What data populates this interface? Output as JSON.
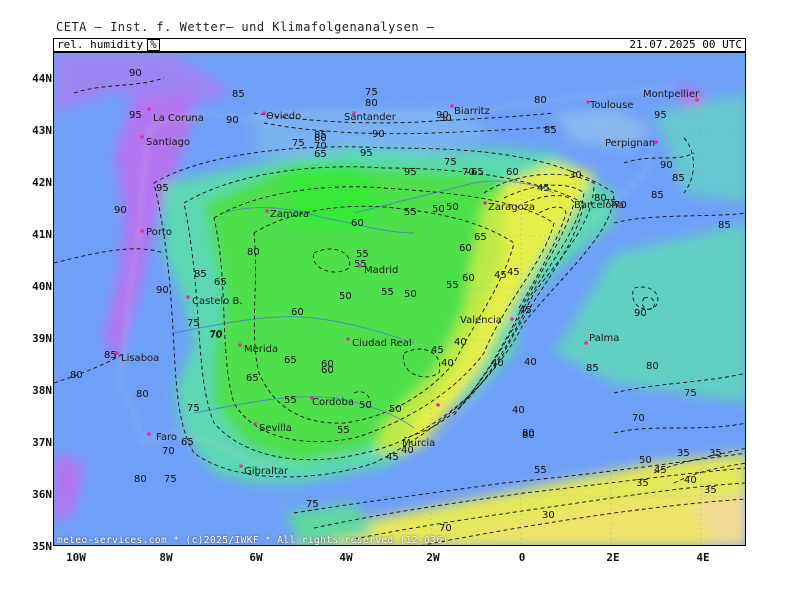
{
  "header": {
    "title": "CETA — Inst. f. Wetter— und Klimafolgenanalysen —",
    "parameter": "rel. humidity",
    "unit": "%",
    "timestamp": "21.07.2025 00 UTC",
    "copyright": "meteo-services.com * (c)2025/IWKF * All rights reserved (12-036)"
  },
  "axes": {
    "lat_labels": [
      "44N",
      "43N",
      "42N",
      "41N",
      "40N",
      "39N",
      "38N",
      "37N",
      "36N",
      "35N"
    ],
    "lon_labels": [
      "10W",
      "8W",
      "6W",
      "4W",
      "2W",
      "0",
      "2E",
      "4E"
    ]
  },
  "cities": [
    "La Coruna",
    "Oviedo",
    "Santander",
    "Biarritz",
    "Toulouse",
    "Montpellier",
    "Santiago",
    "Perpignan",
    "Zaragoza",
    "Zamora",
    "Barcelona",
    "Porto",
    "Madrid",
    "Castelo B.",
    "Valencia",
    "Lisaboa",
    "Merida",
    "Ciudad Real",
    "Palma",
    "Faro",
    "Cordoba",
    "Sevilla",
    "Murcia",
    "Gibraltar"
  ],
  "contour_labels": [
    "90",
    "85",
    "95",
    "90",
    "75",
    "80",
    "85",
    "90",
    "95",
    "80",
    "75",
    "70",
    "65",
    "95",
    "95",
    "90",
    "85",
    "80",
    "75",
    "70",
    "65",
    "60",
    "55",
    "50",
    "45",
    "40",
    "35",
    "90",
    "85",
    "80",
    "60",
    "55",
    "50",
    "60",
    "55",
    "45",
    "40",
    "90",
    "85",
    "80",
    "75",
    "70",
    "65",
    "60",
    "55",
    "50",
    "45",
    "40",
    "80",
    "85",
    "90",
    "80",
    "75",
    "70",
    "65",
    "60",
    "55",
    "50",
    "45",
    "40",
    "85",
    "80",
    "75",
    "70",
    "65",
    "80",
    "75",
    "70",
    "65",
    "60",
    "55",
    "50",
    "45",
    "40",
    "35",
    "30",
    "80",
    "75",
    "70",
    "55",
    "50",
    "45",
    "40",
    "35",
    "30",
    "85",
    "80",
    "75",
    "70",
    "65",
    "60",
    "55",
    "50",
    "45",
    "40",
    "35",
    "30",
    "95",
    "90",
    "85",
    "80"
  ],
  "colors": {
    "sea_humid": "#6fa0f8",
    "very_humid": "#b475f0",
    "dry_interior": "#4ee04c",
    "very_dry": "#e6ef4a"
  }
}
